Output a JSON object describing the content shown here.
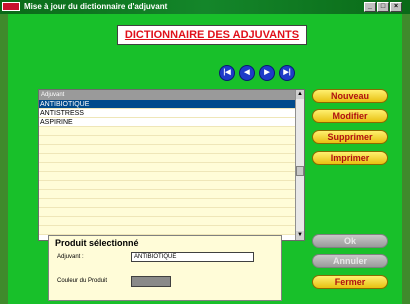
{
  "window": {
    "title": "Mise à jour du dictionnaire d'adjuvant"
  },
  "header": {
    "title": "DICTIONNAIRE DES ADJUVANTS"
  },
  "list": {
    "column_header": "Adjuvant",
    "rows": [
      "ANTIBIOTIQUE",
      "ANTISTRESS",
      "ASPIRINE"
    ],
    "selected_index": 0
  },
  "buttons": {
    "nouveau": "Nouveau",
    "modifier": "Modifier",
    "supprimer": "Supprimer",
    "imprimer": "Imprimer",
    "ok": "Ok",
    "annuler": "Annuler",
    "fermer": "Fermer"
  },
  "product": {
    "title": "Produit sélectionné",
    "adjuvant_label": "Adjuvant :",
    "adjuvant_value": "ANTIBIOTIQUE",
    "color_label": "Couleur du Produit",
    "color_value": "#8a8a8a"
  },
  "colors": {
    "background": "#18c02a",
    "selection": "#004a8c",
    "heading_text": "#e0101a"
  }
}
